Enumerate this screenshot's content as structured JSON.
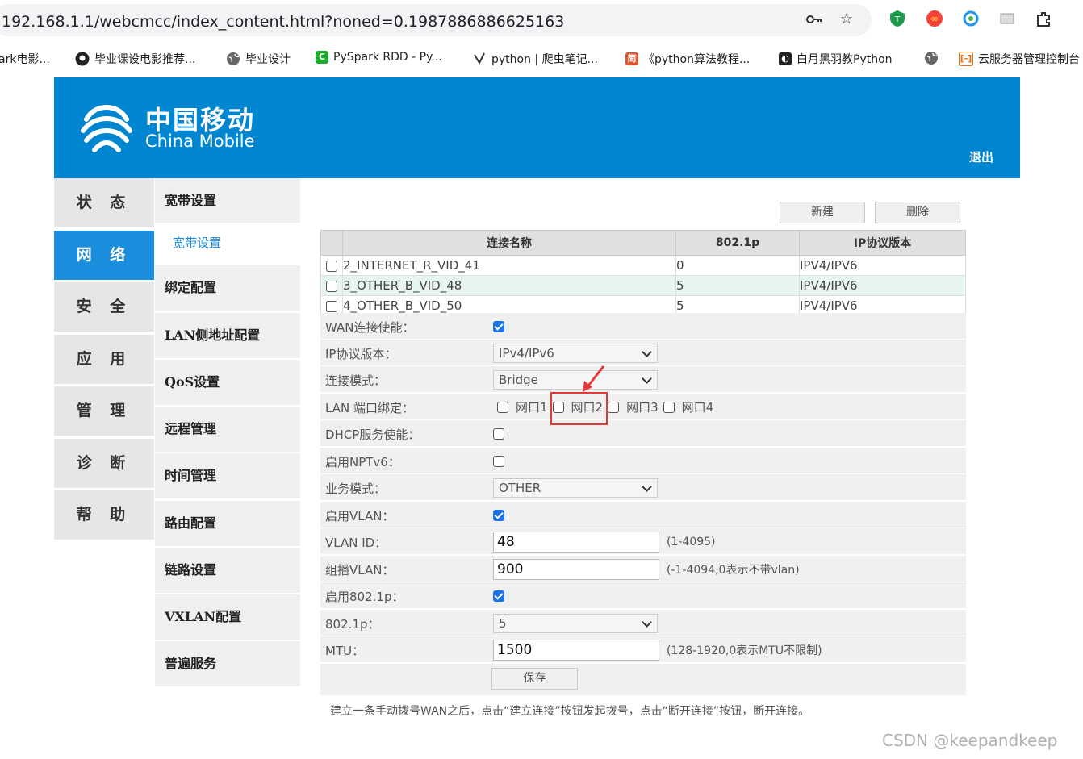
{
  "browser": {
    "url": "192.168.1.1/webcmcc/index_content.html?noned=0.1987886886625163",
    "bookmarks": [
      {
        "label": "ark电影...",
        "icon": "generic"
      },
      {
        "label": "毕业课设电影推荐...",
        "icon": "github-icon"
      },
      {
        "label": "毕业设计",
        "icon": "globe-icon"
      },
      {
        "label": "PySpark RDD - Py...",
        "icon": "green-icon"
      },
      {
        "label": "python | 爬虫笔记...",
        "icon": "yuque-icon"
      },
      {
        "label": "《python算法教程...",
        "icon": "jian-icon"
      },
      {
        "label": "白月黑羽教Python",
        "icon": "book-icon"
      },
      {
        "label": "",
        "icon": "globe-icon"
      },
      {
        "label": "云服务器管理控制台",
        "icon": "aliyun-icon"
      }
    ]
  },
  "header": {
    "brand_cn": "中国移动",
    "brand_en": "China Mobile",
    "logout": "退出"
  },
  "main_nav": [
    "状 态",
    "网 络",
    "安 全",
    "应 用",
    "管 理",
    "诊 断",
    "帮 助"
  ],
  "main_nav_active": "网 络",
  "sub_nav": [
    {
      "label": "宽带设置",
      "active": false
    },
    {
      "label": "宽带设置",
      "active": true
    },
    {
      "label": "绑定配置",
      "active": false
    },
    {
      "label": "LAN侧地址配置",
      "active": false
    },
    {
      "label": "QoS设置",
      "active": false
    },
    {
      "label": "远程管理",
      "active": false
    },
    {
      "label": "时间管理",
      "active": false
    },
    {
      "label": "路由配置",
      "active": false
    },
    {
      "label": "链路设置",
      "active": false
    },
    {
      "label": "VXLAN配置",
      "active": false
    },
    {
      "label": "普遍服务",
      "active": false
    }
  ],
  "buttons": {
    "new": "新建",
    "delete": "删除",
    "save": "保存"
  },
  "table": {
    "headers": [
      "连接名称",
      "802.1p",
      "IP协议版本"
    ],
    "rows": [
      {
        "name": "2_INTERNET_R_VID_41",
        "p8021": "0",
        "ipver": "IPV4/IPV6",
        "highlight": false
      },
      {
        "name": "3_OTHER_B_VID_48",
        "p8021": "5",
        "ipver": "IPV4/IPV6",
        "highlight": true
      },
      {
        "name": "4_OTHER_B_VID_50",
        "p8021": "5",
        "ipver": "IPV4/IPV6",
        "highlight": false
      }
    ]
  },
  "form": {
    "wan_enable": {
      "label": "WAN连接使能：",
      "checked": true
    },
    "ip_version": {
      "label": "IP协议版本：",
      "value": "IPv4/IPv6"
    },
    "conn_mode": {
      "label": "连接模式：",
      "value": "Bridge"
    },
    "lan_bind": {
      "label": "LAN 端口绑定：",
      "ports": [
        "网口1",
        "网口2",
        "网口3",
        "网口4"
      ]
    },
    "dhcp": {
      "label": "DHCP服务使能：",
      "checked": false
    },
    "nptv6": {
      "label": "启用NPTv6：",
      "checked": false
    },
    "service_mode": {
      "label": "业务模式：",
      "value": "OTHER"
    },
    "vlan_enable": {
      "label": "启用VLAN：",
      "checked": true
    },
    "vlan_id": {
      "label": "VLAN ID：",
      "value": "48",
      "hint": "(1-4095)"
    },
    "multicast_vlan": {
      "label": "组播VLAN：",
      "value": "900",
      "hint": "(-1-4094,0表示不带vlan)"
    },
    "p8021_enable": {
      "label": "启用802.1p：",
      "checked": true
    },
    "p8021": {
      "label": "802.1p：",
      "value": "5"
    },
    "mtu": {
      "label": "MTU：",
      "value": "1500",
      "hint": "(128-1920,0表示MTU不限制)"
    }
  },
  "footnote": "建立一条手动拨号WAN之后，点击“建立连接”按钮发起拨号，点击“断开连接”按钮，断开连接。",
  "watermark": "CSDN @keepandkeep",
  "colors": {
    "header": "#0085d0",
    "nav_active": "#1a8ddc",
    "annotation": "#e53935",
    "checkbox": "#1a73e8"
  }
}
